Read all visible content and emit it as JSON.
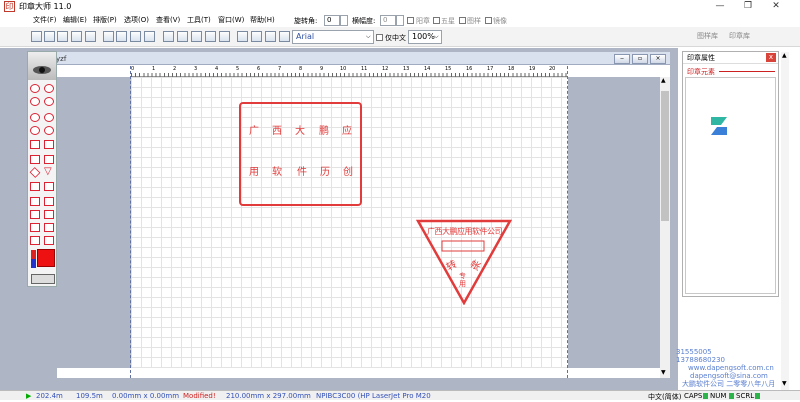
{
  "window": {
    "title": "印章大师 11.0",
    "controls": [
      "—",
      "❐",
      "✕"
    ]
  },
  "menu": [
    "文件(F)",
    "编辑(E)",
    "排版(P)",
    "选项(O)",
    "查看(V)",
    "工具(T)",
    "窗口(W)",
    "帮助(H)"
  ],
  "options": {
    "rotation_label": "旋转角:",
    "rotation_value": "0",
    "skew_label": "横幅度:",
    "skew_value": "0",
    "stamp_label": "阳章",
    "star_label": "五星",
    "pattern_label": "图样",
    "mirror_label": "镜像"
  },
  "font": {
    "name": "Arial",
    "only_chinese_label": "仅中文",
    "zoom": "100%"
  },
  "right_tabs": [
    "图样库",
    "印章库"
  ],
  "document": {
    "tab_label": "yzf"
  },
  "ruler": [
    "0",
    "1",
    "2",
    "3",
    "4",
    "5",
    "6",
    "7",
    "8",
    "9",
    "10",
    "11",
    "12",
    "13",
    "14",
    "15",
    "16",
    "17",
    "18",
    "19",
    "20"
  ],
  "seal_rect": {
    "row1": [
      "广",
      "西",
      "大",
      "鹏",
      "应"
    ],
    "row2": [
      "用",
      "软",
      "件",
      "历",
      "创"
    ]
  },
  "seal_triangle": {
    "top_text": "广西大鹏应用软件公司",
    "left": "转",
    "right": "帐",
    "bottom": "专用"
  },
  "properties": {
    "title": "印章属性",
    "close": "x",
    "elements_label": "印章元素"
  },
  "contact": {
    "line1": "31555005",
    "line2": "13788680230",
    "line3": "www.dapengsoft.com.cn",
    "line4": "dapengsoft@sina.com",
    "line5": "大鹏软件公司 二零零八年八月"
  },
  "status": {
    "x": "202.4m",
    "y": "109.5m",
    "size": "0.00mm x 0.00mm",
    "modified": "Modified!",
    "page": "210.00mm x 297.00mm",
    "printer": "NPIBC3C00 (HP LaserJet Pro M20",
    "ime": "中文(简体)",
    "caps": "CAPS",
    "num": "NUM",
    "scrl": "SCRL"
  },
  "colors": {
    "seal_red": "#e23b3b",
    "accent_blue": "#3350b8"
  }
}
